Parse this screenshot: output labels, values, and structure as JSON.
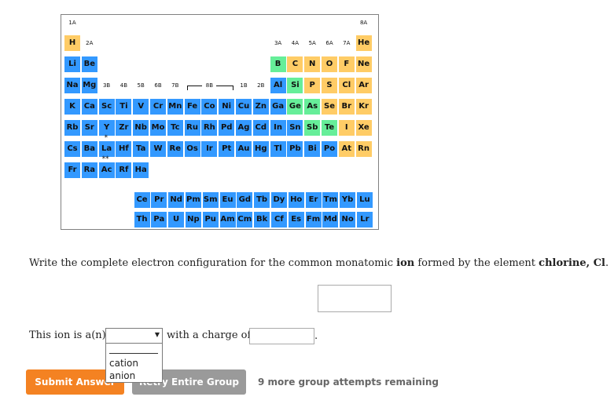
{
  "periodic_table": {
    "group_labels": [
      {
        "text": "1A"
      },
      {
        "text": "2A"
      },
      {
        "text": "3B"
      },
      {
        "text": "4B"
      },
      {
        "text": "5B"
      },
      {
        "text": "6B"
      },
      {
        "text": "7B"
      },
      {
        "text": "8B"
      },
      {
        "text": "1B"
      },
      {
        "text": "2B"
      },
      {
        "text": "3A"
      },
      {
        "text": "4A"
      },
      {
        "text": "5A"
      },
      {
        "text": "6A"
      },
      {
        "text": "7A"
      },
      {
        "text": "8A"
      }
    ],
    "colors": {
      "metal": "#3399ff",
      "nonmetal": "#ffcc66",
      "metalloid": "#66ee99"
    },
    "rows": [
      [
        [
          "H",
          "nonmetal",
          0
        ],
        [
          "He",
          "nonmetal",
          17
        ]
      ],
      [
        [
          "Li",
          "metal",
          0
        ],
        [
          "Be",
          "metal",
          1
        ],
        [
          "B",
          "metalloid",
          12
        ],
        [
          "C",
          "nonmetal",
          13
        ],
        [
          "N",
          "nonmetal",
          14
        ],
        [
          "O",
          "nonmetal",
          15
        ],
        [
          "F",
          "nonmetal",
          16
        ],
        [
          "Ne",
          "nonmetal",
          17
        ]
      ],
      [
        [
          "Na",
          "metal",
          0
        ],
        [
          "Mg",
          "metal",
          1
        ],
        [
          "Al",
          "metal",
          12
        ],
        [
          "Si",
          "metalloid",
          13
        ],
        [
          "P",
          "nonmetal",
          14
        ],
        [
          "S",
          "nonmetal",
          15
        ],
        [
          "Cl",
          "nonmetal",
          16
        ],
        [
          "Ar",
          "nonmetal",
          17
        ]
      ],
      [
        [
          "K",
          "metal",
          0
        ],
        [
          "Ca",
          "metal",
          1
        ],
        [
          "Sc",
          "metal",
          2
        ],
        [
          "Ti",
          "metal",
          3
        ],
        [
          "V",
          "metal",
          4
        ],
        [
          "Cr",
          "metal",
          5
        ],
        [
          "Mn",
          "metal",
          6
        ],
        [
          "Fe",
          "metal",
          7
        ],
        [
          "Co",
          "metal",
          8
        ],
        [
          "Ni",
          "metal",
          9
        ],
        [
          "Cu",
          "metal",
          10
        ],
        [
          "Zn",
          "metal",
          11
        ],
        [
          "Ga",
          "metal",
          12
        ],
        [
          "Ge",
          "metalloid",
          13
        ],
        [
          "As",
          "metalloid",
          14
        ],
        [
          "Se",
          "nonmetal",
          15
        ],
        [
          "Br",
          "nonmetal",
          16
        ],
        [
          "Kr",
          "nonmetal",
          17
        ]
      ],
      [
        [
          "Rb",
          "metal",
          0
        ],
        [
          "Sr",
          "metal",
          1
        ],
        [
          "Y",
          "metal",
          2
        ],
        [
          "Zr",
          "metal",
          3
        ],
        [
          "Nb",
          "metal",
          4
        ],
        [
          "Mo",
          "metal",
          5
        ],
        [
          "Tc",
          "metal",
          6
        ],
        [
          "Ru",
          "metal",
          7
        ],
        [
          "Rh",
          "metal",
          8
        ],
        [
          "Pd",
          "metal",
          9
        ],
        [
          "Ag",
          "metal",
          10
        ],
        [
          "Cd",
          "metal",
          11
        ],
        [
          "In",
          "metal",
          12
        ],
        [
          "Sn",
          "metal",
          13
        ],
        [
          "Sb",
          "metalloid",
          14
        ],
        [
          "Te",
          "metalloid",
          15
        ],
        [
          "I",
          "nonmetal",
          16
        ],
        [
          "Xe",
          "nonmetal",
          17
        ]
      ],
      [
        [
          "Cs",
          "metal",
          0
        ],
        [
          "Ba",
          "metal",
          1
        ],
        [
          "La",
          "metal",
          2
        ],
        [
          "Hf",
          "metal",
          3
        ],
        [
          "Ta",
          "metal",
          4
        ],
        [
          "W",
          "metal",
          5
        ],
        [
          "Re",
          "metal",
          6
        ],
        [
          "Os",
          "metal",
          7
        ],
        [
          "Ir",
          "metal",
          8
        ],
        [
          "Pt",
          "metal",
          9
        ],
        [
          "Au",
          "metal",
          10
        ],
        [
          "Hg",
          "metal",
          11
        ],
        [
          "Tl",
          "metal",
          12
        ],
        [
          "Pb",
          "metal",
          13
        ],
        [
          "Bi",
          "metal",
          14
        ],
        [
          "Po",
          "metal",
          15
        ],
        [
          "At",
          "nonmetal",
          16
        ],
        [
          "Rn",
          "nonmetal",
          17
        ]
      ],
      [
        [
          "Fr",
          "metal",
          0
        ],
        [
          "Ra",
          "metal",
          1
        ],
        [
          "Ac",
          "metal",
          2
        ],
        [
          "Rf",
          "metal",
          3
        ],
        [
          "Ha",
          "metal",
          4
        ]
      ]
    ],
    "lanthanides": [
      "Ce",
      "Pr",
      "Nd",
      "Pm",
      "Sm",
      "Eu",
      "Gd",
      "Tb",
      "Dy",
      "Ho",
      "Er",
      "Tm",
      "Yb",
      "Lu"
    ],
    "actinides": [
      "Th",
      "Pa",
      "U",
      "Np",
      "Pu",
      "Am",
      "Cm",
      "Bk",
      "Cf",
      "Es",
      "Fm",
      "Md",
      "No",
      "Lr"
    ],
    "la_mark": "*",
    "ac_mark": "**"
  },
  "question": {
    "prefix": "Write the complete electron configuration for the common monatomic ",
    "ion_word": "ion",
    "middle": " formed by the element ",
    "element": "chlorine, Cl",
    "suffix": "."
  },
  "ion_type": {
    "label": "This ion is a(n)",
    "selected": "",
    "options": [
      "cation",
      "anion"
    ],
    "charge_label": "with a charge of",
    "charge_value": "",
    "end": "."
  },
  "footer": {
    "submit_label": "Submit Answer",
    "retry_label": "Retry Entire Group",
    "attempts_text": "9 more group attempts remaining"
  }
}
